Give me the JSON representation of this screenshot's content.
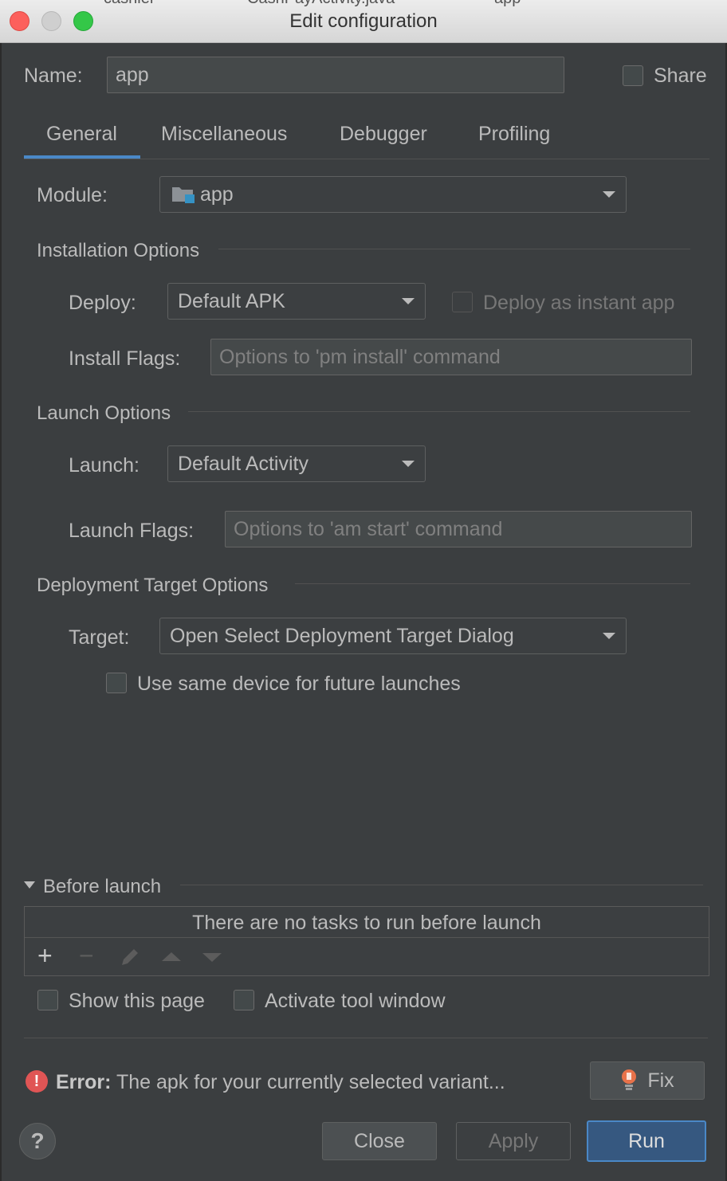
{
  "window": {
    "title": "Edit configuration",
    "bg_tabs": [
      "cashier",
      "CashPayActivity.java",
      "app"
    ]
  },
  "name": {
    "label": "Name:",
    "value": "app"
  },
  "share": {
    "label": "Share",
    "checked": false
  },
  "tabs": [
    {
      "label": "General",
      "active": true
    },
    {
      "label": "Miscellaneous",
      "active": false
    },
    {
      "label": "Debugger",
      "active": false
    },
    {
      "label": "Profiling",
      "active": false
    }
  ],
  "module": {
    "label": "Module:",
    "value": "app",
    "icon": "folder-module-icon"
  },
  "installation": {
    "section_title": "Installation Options",
    "deploy_label": "Deploy:",
    "deploy_value": "Default APK",
    "instant_app_label": "Deploy as instant app",
    "instant_app_checked": false,
    "install_flags_label": "Install Flags:",
    "install_flags_placeholder": "Options to 'pm install' command"
  },
  "launch": {
    "section_title": "Launch Options",
    "launch_label": "Launch:",
    "launch_value": "Default Activity",
    "launch_flags_label": "Launch Flags:",
    "launch_flags_placeholder": "Options to 'am start' command"
  },
  "deployment": {
    "section_title": "Deployment Target Options",
    "target_label": "Target:",
    "target_value": "Open Select Deployment Target Dialog",
    "same_device_label": "Use same device for future launches",
    "same_device_checked": false
  },
  "before_launch": {
    "title": "Before launch",
    "empty_text": "There are no tasks to run before launch",
    "toolbar": [
      "add-icon",
      "remove-icon",
      "edit-icon",
      "move-up-icon",
      "move-down-icon"
    ]
  },
  "options": {
    "show_page_label": "Show this page",
    "activate_tool_label": "Activate tool window"
  },
  "error": {
    "prefix": "Error:",
    "message": "The apk for your currently selected variant...",
    "fix_label": "Fix"
  },
  "buttons": {
    "help": "?",
    "close": "Close",
    "apply": "Apply",
    "run": "Run"
  },
  "colors": {
    "background": "#3b3e40",
    "accent": "#4a88c7",
    "error": "#e05555",
    "primary_button": "#365880"
  }
}
